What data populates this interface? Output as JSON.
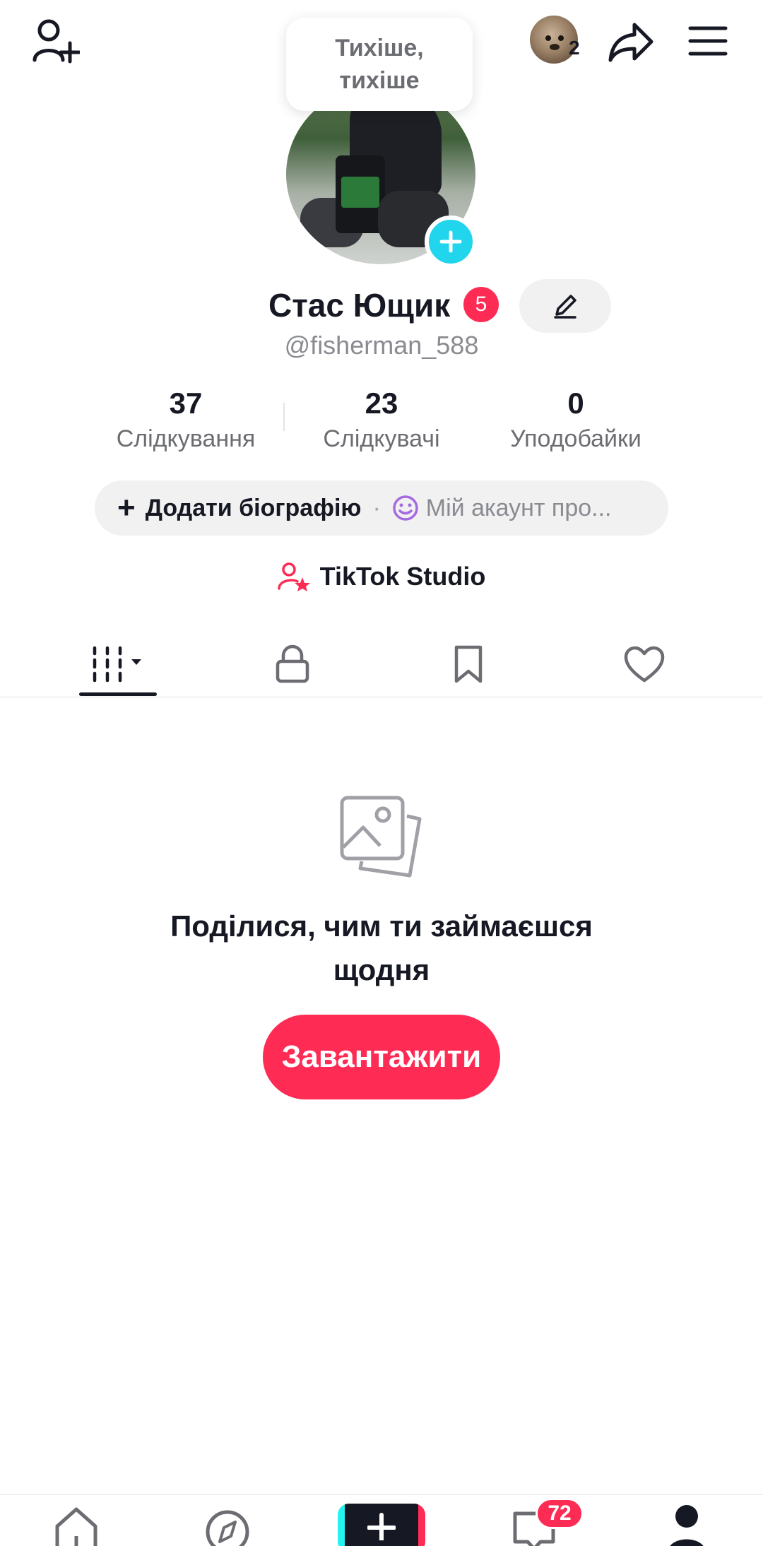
{
  "colors": {
    "accent": "#fe2c55",
    "cyan": "#20d5ec",
    "text": "#161823",
    "muted": "#6c6d72",
    "pill_bg": "#f1f1f2"
  },
  "header": {
    "add_friend_icon": "add-user-icon",
    "friends_count": "2",
    "share_icon": "share-icon",
    "menu_icon": "menu-icon"
  },
  "tooltip": {
    "line1": "Тихіше,",
    "line2": "тихіше"
  },
  "profile": {
    "name": "Стас Ющик",
    "name_badge": "5",
    "handle": "@fisherman_588",
    "edit_icon": "pencil-icon"
  },
  "stats": [
    {
      "value": "37",
      "label": "Слідкування"
    },
    {
      "value": "23",
      "label": "Слідкувачі"
    },
    {
      "value": "0",
      "label": "Уподобайки"
    }
  ],
  "bio": {
    "plus": "+",
    "add_label": "Додати біографію",
    "separator": "·",
    "about_label": "Мій акаунт про..."
  },
  "studio": {
    "label": "TikTok Studio"
  },
  "tabs": [
    {
      "name": "videos",
      "icon": "grid-icon",
      "active": true
    },
    {
      "name": "private",
      "icon": "lock-icon",
      "active": false
    },
    {
      "name": "saved",
      "icon": "bookmark-icon",
      "active": false
    },
    {
      "name": "liked",
      "icon": "heart-icon",
      "active": false
    }
  ],
  "empty_state": {
    "icon": "photos-icon",
    "title_line1": "Поділися, чим ти займаєшся",
    "title_line2": "щодня",
    "button": "Завантажити"
  },
  "bottom_nav": {
    "home_icon": "home-icon",
    "explore_icon": "compass-icon",
    "create_icon": "plus-icon",
    "inbox_icon": "inbox-icon",
    "inbox_badge": "72",
    "profile_icon": "profile-icon"
  }
}
